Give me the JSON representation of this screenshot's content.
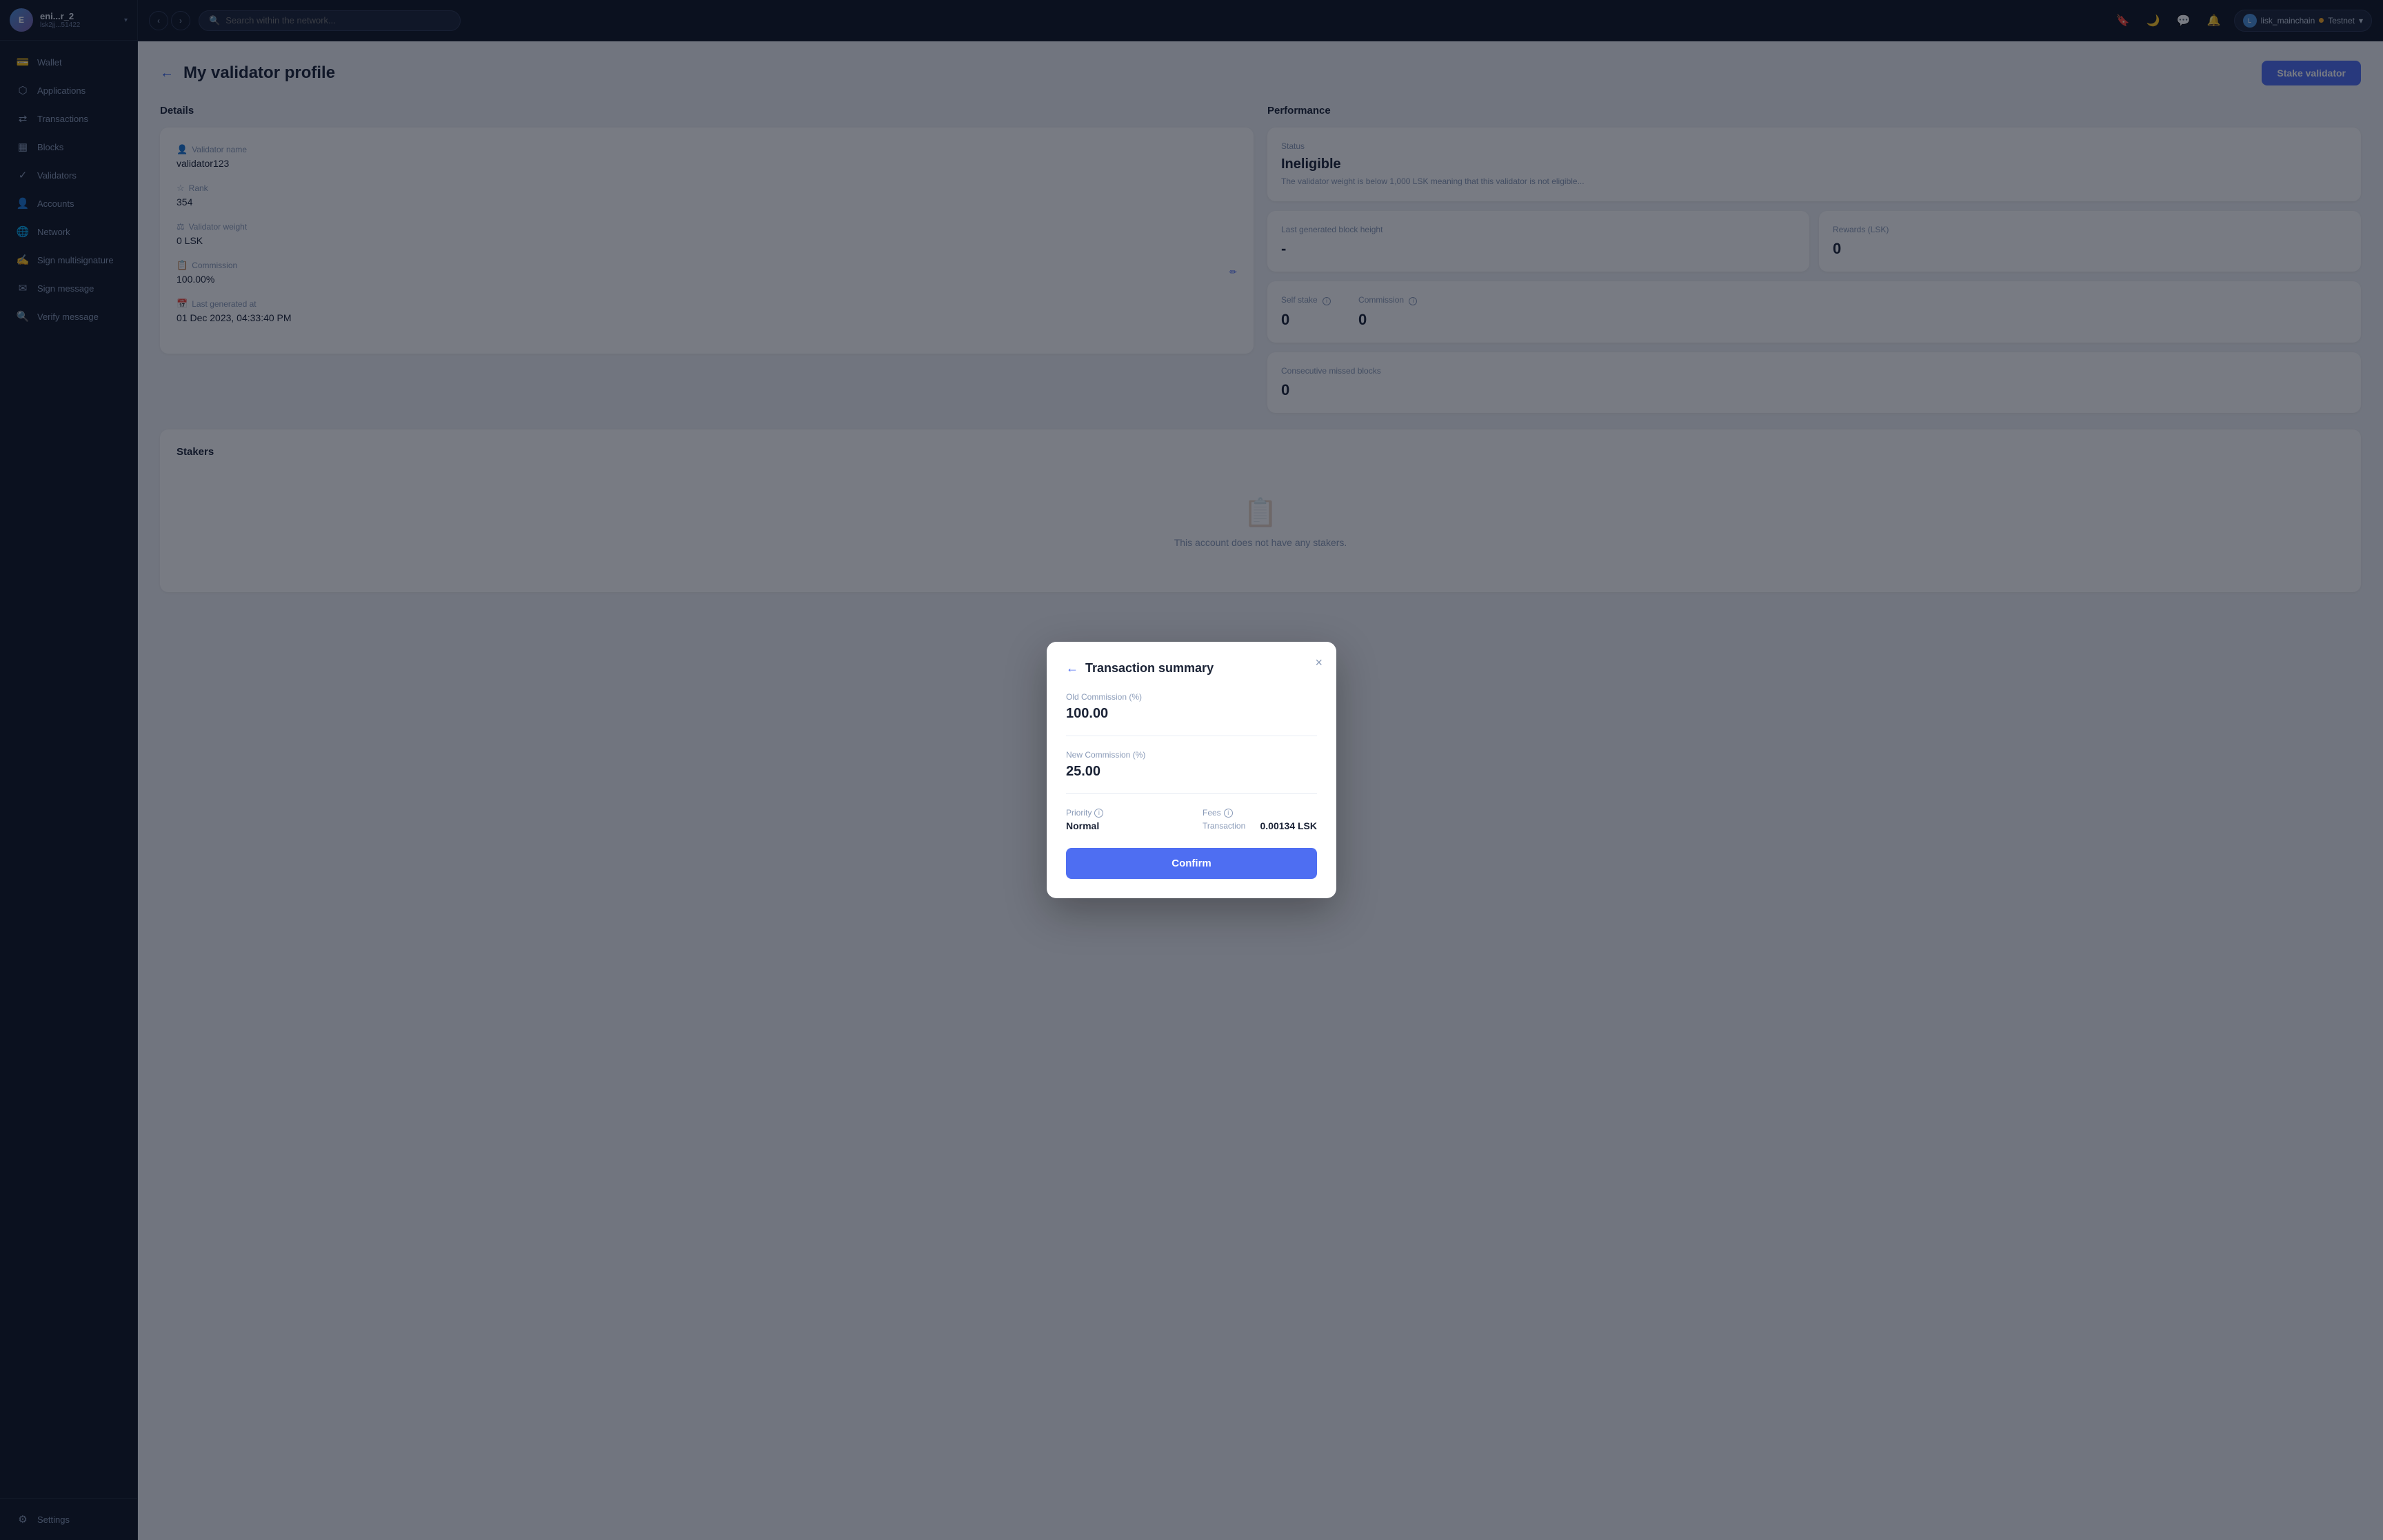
{
  "sidebar": {
    "account": {
      "name": "eni...r_2",
      "address": "lsk2jj...51422",
      "avatar_initials": "E"
    },
    "nav_items": [
      {
        "id": "wallet",
        "label": "Wallet",
        "icon": "💳"
      },
      {
        "id": "applications",
        "label": "Applications",
        "icon": "⬡"
      },
      {
        "id": "transactions",
        "label": "Transactions",
        "icon": "↔"
      },
      {
        "id": "blocks",
        "label": "Blocks",
        "icon": "▦"
      },
      {
        "id": "validators",
        "label": "Validators",
        "icon": "✓"
      },
      {
        "id": "accounts",
        "label": "Accounts",
        "icon": "👤"
      },
      {
        "id": "network",
        "label": "Network",
        "icon": "🌐"
      },
      {
        "id": "sign-multisignature",
        "label": "Sign multisignature",
        "icon": "✍"
      },
      {
        "id": "sign-message",
        "label": "Sign message",
        "icon": "✉"
      },
      {
        "id": "verify-message",
        "label": "Verify message",
        "icon": "🔍"
      }
    ],
    "settings_label": "Settings"
  },
  "topbar": {
    "search_placeholder": "Search within the network...",
    "network_user": "lisk_mainchain",
    "network_env": "Testnet"
  },
  "page": {
    "title": "My validator profile",
    "stake_button": "Stake validator",
    "back_icon": "←"
  },
  "details": {
    "section_title": "Details",
    "validator_name_label": "Validator name",
    "validator_name_value": "validator123",
    "rank_label": "Rank",
    "rank_value": "354",
    "validator_weight_label": "Validator weight",
    "validator_weight_value": "0 LSK",
    "commission_label": "Commission",
    "commission_value": "100.00%",
    "last_generated_label": "Last generated at",
    "last_generated_value": "01 Dec 2023, 04:33:40 PM"
  },
  "performance": {
    "section_title": "Performance",
    "status_label": "Status",
    "status_value": "Ineligible",
    "status_desc": "The validator weight is below 1,000 LSK meaning that this validator is not eligible...",
    "last_block_label": "Last generated block height",
    "last_block_value": "-",
    "rewards_label": "Rewards (LSK)",
    "rewards_value": "0",
    "self_stake_label": "Self stake",
    "self_stake_value": "0",
    "commission_label": "Commission",
    "commission_value": "0",
    "missed_blocks_label": "Consecutive missed blocks",
    "missed_blocks_value": "0"
  },
  "stakers": {
    "section_title": "Stakers",
    "empty_message": "This account does not have any stakers."
  },
  "modal": {
    "title": "Transaction summary",
    "back_icon": "←",
    "close_icon": "×",
    "old_commission_label": "Old Commission (%)",
    "old_commission_value": "100.00",
    "new_commission_label": "New Commission (%)",
    "new_commission_value": "25.00",
    "priority_label": "Priority",
    "priority_value": "Normal",
    "fees_label": "Fees",
    "fee_transaction_label": "Transaction",
    "fee_transaction_value": "0.00134 LSK",
    "confirm_button": "Confirm"
  }
}
